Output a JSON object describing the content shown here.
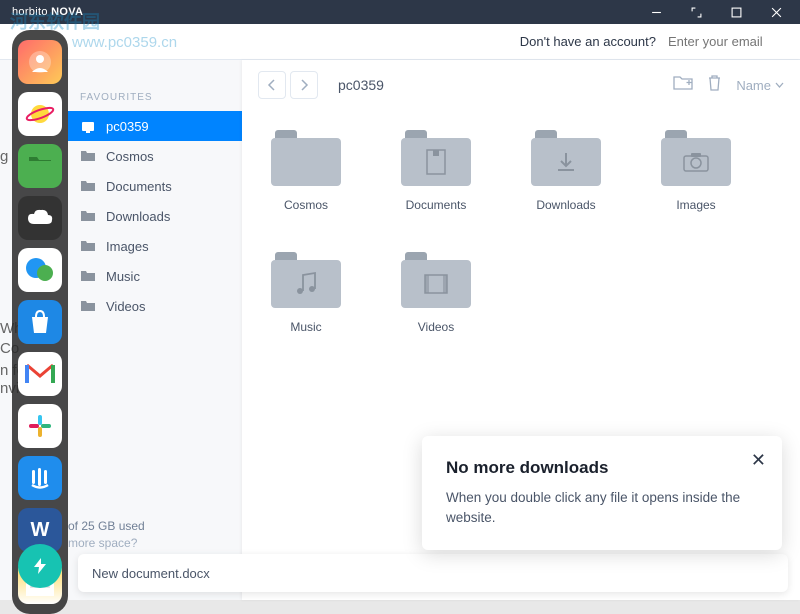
{
  "titlebar": {
    "brand_a": "horbito",
    "brand_b": "NOVA"
  },
  "watermark": {
    "line1": "河东软件园",
    "line2": "www.pc0359.cn"
  },
  "account": {
    "prompt": "Don't have an account?",
    "placeholder": "Enter your email"
  },
  "sidebar": {
    "header": "FAVOURITES",
    "items": [
      {
        "label": "pc0359"
      },
      {
        "label": "Cosmos"
      },
      {
        "label": "Documents"
      },
      {
        "label": "Downloads"
      },
      {
        "label": "Images"
      },
      {
        "label": "Music"
      },
      {
        "label": "Videos"
      }
    ]
  },
  "storage": {
    "used": "of 25 GB used",
    "more": "more space?"
  },
  "newdoc": {
    "name": "New document.docx"
  },
  "toolbar": {
    "breadcrumb": "pc0359",
    "sort": "Name"
  },
  "folders": [
    {
      "label": "Cosmos",
      "glyph": ""
    },
    {
      "label": "Documents",
      "glyph": "doc"
    },
    {
      "label": "Downloads",
      "glyph": "down"
    },
    {
      "label": "Images",
      "glyph": "cam"
    },
    {
      "label": "Music",
      "glyph": "note"
    },
    {
      "label": "Videos",
      "glyph": "film"
    }
  ],
  "tooltip": {
    "title": "No more downloads",
    "body": "When you double click any file it opens inside the website."
  },
  "bg": {
    "t1": "Wh",
    "t2": "Co",
    "t3": "n fo",
    "t4": "nvi"
  }
}
